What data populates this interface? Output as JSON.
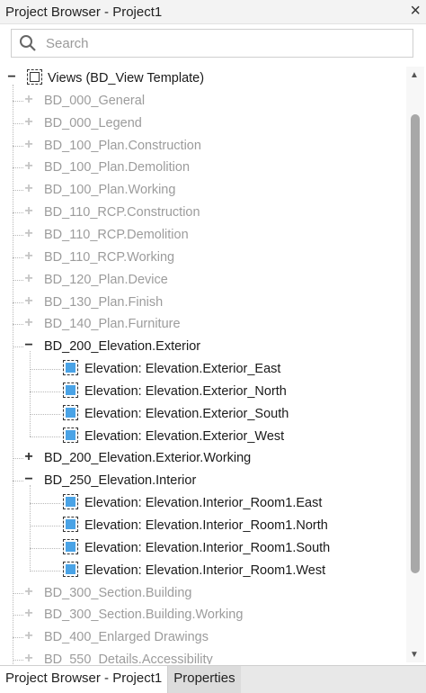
{
  "window": {
    "title": "Project Browser - Project1",
    "close_glyph": "×"
  },
  "search": {
    "placeholder": "Search",
    "value": ""
  },
  "tree": {
    "root": {
      "label": "Views (BD_View Template)",
      "expanded": true
    },
    "nodes": [
      {
        "label": "BD_000_General",
        "state": "collapsed",
        "disabled": true
      },
      {
        "label": "BD_000_Legend",
        "state": "collapsed",
        "disabled": true
      },
      {
        "label": "BD_100_Plan.Construction",
        "state": "collapsed",
        "disabled": true
      },
      {
        "label": "BD_100_Plan.Demolition",
        "state": "collapsed",
        "disabled": true
      },
      {
        "label": "BD_100_Plan.Working",
        "state": "collapsed",
        "disabled": true
      },
      {
        "label": "BD_110_RCP.Construction",
        "state": "collapsed",
        "disabled": true
      },
      {
        "label": "BD_110_RCP.Demolition",
        "state": "collapsed",
        "disabled": true
      },
      {
        "label": "BD_110_RCP.Working",
        "state": "collapsed",
        "disabled": true
      },
      {
        "label": "BD_120_Plan.Device",
        "state": "collapsed",
        "disabled": true
      },
      {
        "label": "BD_130_Plan.Finish",
        "state": "collapsed",
        "disabled": true
      },
      {
        "label": "BD_140_Plan.Furniture",
        "state": "collapsed",
        "disabled": true
      },
      {
        "label": "BD_200_Elevation.Exterior",
        "state": "expanded",
        "disabled": false,
        "children": [
          "Elevation: Elevation.Exterior_East",
          "Elevation: Elevation.Exterior_North",
          "Elevation: Elevation.Exterior_South",
          "Elevation: Elevation.Exterior_West"
        ]
      },
      {
        "label": "BD_200_Elevation.Exterior.Working",
        "state": "collapsed",
        "disabled": false
      },
      {
        "label": "BD_250_Elevation.Interior",
        "state": "expanded",
        "disabled": false,
        "children": [
          "Elevation: Elevation.Interior_Room1.East",
          "Elevation: Elevation.Interior_Room1.North",
          "Elevation: Elevation.Interior_Room1.South",
          "Elevation: Elevation.Interior_Room1.West"
        ]
      },
      {
        "label": "BD_300_Section.Building",
        "state": "collapsed",
        "disabled": true
      },
      {
        "label": "BD_300_Section.Building.Working",
        "state": "collapsed",
        "disabled": true
      },
      {
        "label": "BD_400_Enlarged Drawings",
        "state": "collapsed",
        "disabled": true
      },
      {
        "label": "BD_550_Details.Accessibility",
        "state": "collapsed",
        "disabled": true
      }
    ]
  },
  "tabs": [
    {
      "label": "Project Browser - Project1",
      "active": true
    },
    {
      "label": "Properties",
      "active": false
    }
  ],
  "colors": {
    "view_icon": "#4aa3e6",
    "disabled_text": "#9c9c9c",
    "text": "#1a1a1a"
  }
}
